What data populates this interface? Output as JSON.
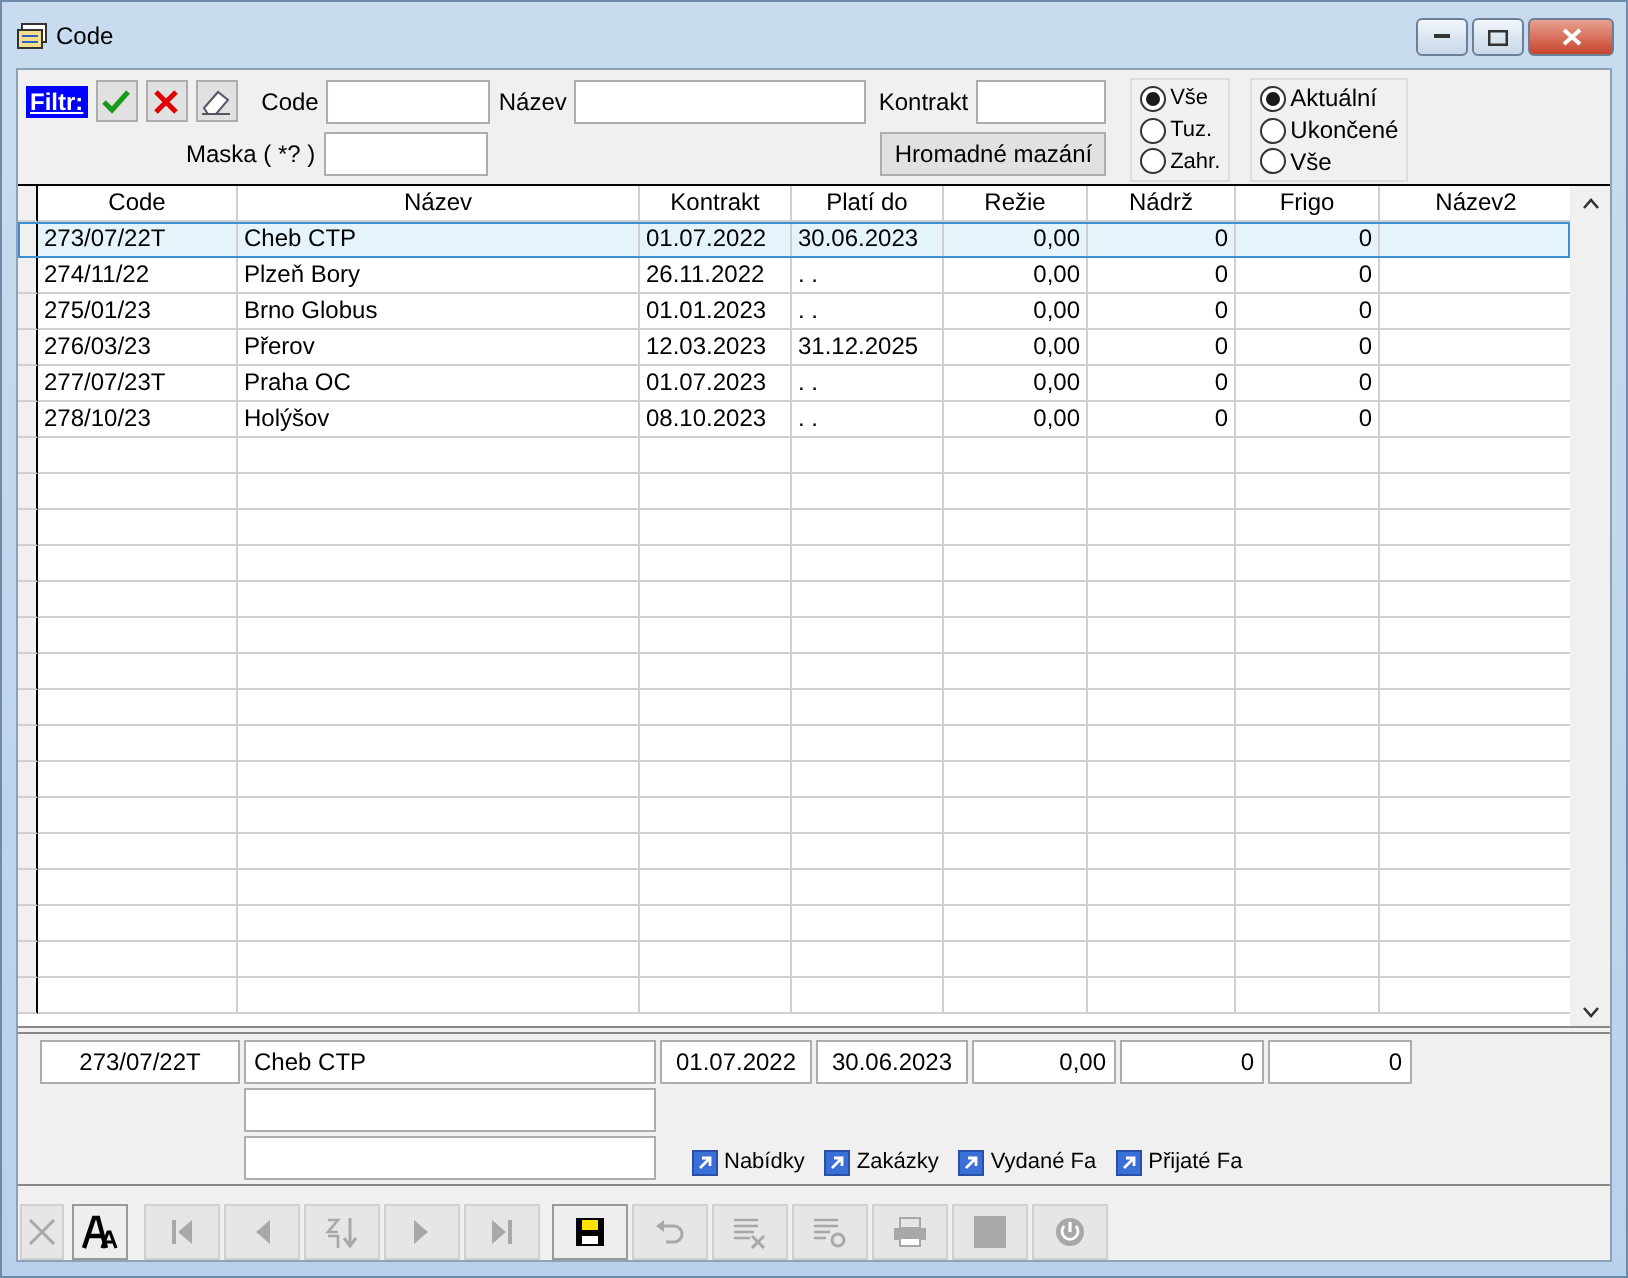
{
  "window": {
    "title": "Code"
  },
  "filter": {
    "label": "Filtr:",
    "buttons": [
      {
        "kind": "apply"
      },
      {
        "kind": "cancel"
      },
      {
        "kind": "clear"
      }
    ],
    "fields": [
      {
        "label": "Code"
      },
      {
        "label": "Název"
      },
      {
        "label": "Kontrakt"
      },
      {
        "label": "Maska ( *? )"
      }
    ],
    "bulk_delete": "Hromadné mazání",
    "origin": [
      {
        "label": "Vše",
        "selected": true
      },
      {
        "label": "Tuz.",
        "selected": false
      },
      {
        "label": "Zahr.",
        "selected": false
      }
    ],
    "status": [
      {
        "label": "Aktuální",
        "selected": true
      },
      {
        "label": "Ukončené",
        "selected": false
      },
      {
        "label": "Vše",
        "selected": false
      }
    ]
  },
  "table": {
    "columns": [
      "Code",
      "Název",
      "Kontrakt",
      "Platí do",
      "Režie",
      "Nádrž",
      "Frigo",
      "Název2"
    ],
    "rows": [
      {
        "selected": true,
        "cells": [
          "273/07/22T",
          "Cheb CTP",
          "01.07.2022",
          "30.06.2023",
          "0,00",
          "0",
          "0"
        ]
      },
      {
        "selected": false,
        "cells": [
          "274/11/22",
          "Plzeň Bory",
          "26.11.2022",
          ". .",
          "0,00",
          "0",
          "0"
        ]
      },
      {
        "selected": false,
        "cells": [
          "275/01/23",
          "Brno Globus",
          "01.01.2023",
          ". .",
          "0,00",
          "0",
          "0"
        ]
      },
      {
        "selected": false,
        "cells": [
          "276/03/23",
          "Přerov",
          "12.03.2023",
          "31.12.2025",
          "0,00",
          "0",
          "0"
        ]
      },
      {
        "selected": false,
        "cells": [
          "277/07/23T",
          "Praha OC",
          "01.07.2023",
          ". .",
          "0,00",
          "0",
          "0"
        ]
      },
      {
        "selected": false,
        "cells": [
          "278/10/23",
          "Holýšov",
          "08.10.2023",
          ". .",
          "0,00",
          "0",
          "0"
        ]
      }
    ]
  },
  "detail": {
    "code": "273/07/22T",
    "name": "Cheb CTP",
    "contract": "01.07.2022",
    "valid_to": "30.06.2023",
    "overhead": "0,00",
    "tank": "0",
    "fridge": "0",
    "links": [
      "Nabídky",
      "Zakázky",
      "Vydané Fa",
      "Přijaté Fa"
    ]
  },
  "toolbar": [
    {
      "kind": "delete",
      "disabled": true
    },
    {
      "kind": "font",
      "disabled": false
    },
    {
      "kind": "first",
      "disabled": true
    },
    {
      "kind": "prev",
      "disabled": true
    },
    {
      "kind": "sort",
      "disabled": true
    },
    {
      "kind": "next",
      "disabled": true
    },
    {
      "kind": "last",
      "disabled": true
    },
    {
      "kind": "save",
      "disabled": false
    },
    {
      "kind": "undo",
      "disabled": true
    },
    {
      "kind": "edit",
      "disabled": true
    },
    {
      "kind": "find",
      "disabled": true
    },
    {
      "kind": "print",
      "disabled": true
    },
    {
      "kind": "stop",
      "disabled": true
    },
    {
      "kind": "power",
      "disabled": true
    }
  ]
}
